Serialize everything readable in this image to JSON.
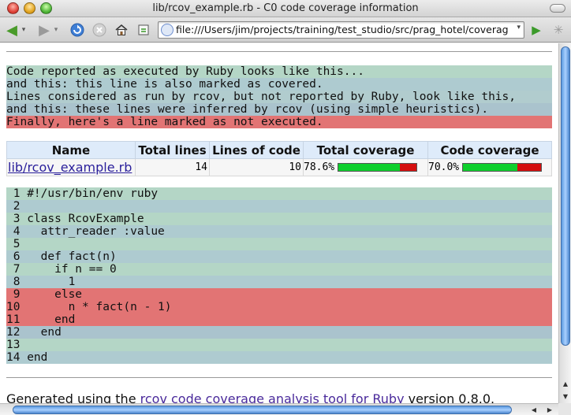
{
  "window": {
    "title": "lib/rcov_example.rb - C0 code coverage information"
  },
  "toolbar": {
    "back": "◀",
    "forward": "▶",
    "drop": "▾",
    "reload": "↻",
    "stop": "✕",
    "home": "⌂",
    "bookmark": "▣",
    "url": "file:///Users/jim/projects/training/test_studio/src/prag_hotel/coverage/lib",
    "go": "▶",
    "throbber": "✳",
    "icons": [
      "back-arrow-icon",
      "forward-arrow-icon",
      "reload-icon",
      "stop-icon",
      "home-icon",
      "bookmark-icon",
      "go-icon",
      "throbber-icon"
    ]
  },
  "legend": [
    {
      "text": "Code reported as executed by Ruby looks like this...",
      "kind": "cov1"
    },
    {
      "text": "and this: this line is also marked as covered.",
      "kind": "cov2"
    },
    {
      "text": "Lines considered as run by rcov, but not reported by Ruby, look like this,",
      "kind": "inf1"
    },
    {
      "text": "and this: these lines were inferred by rcov (using simple heuristics).",
      "kind": "inf2"
    },
    {
      "text": "Finally, here's a line marked as not executed.",
      "kind": "notcov"
    }
  ],
  "report": {
    "headers": [
      "Name",
      "Total lines",
      "Lines of code",
      "Total coverage",
      "Code coverage"
    ],
    "row": {
      "name": "lib/rcov_example.rb",
      "total_lines": "14",
      "lines_of_code": "10",
      "total_coverage": "78.6%",
      "total_coverage_value": 0.786,
      "code_coverage": "70.0%",
      "code_coverage_value": 0.7
    }
  },
  "code": [
    {
      "text": " 1 #!/usr/bin/env ruby",
      "kind": "cov1"
    },
    {
      "text": " 2",
      "kind": "cov2"
    },
    {
      "text": " 3 class RcovExample",
      "kind": "cov1"
    },
    {
      "text": " 4   attr_reader :value",
      "kind": "cov2"
    },
    {
      "text": " 5",
      "kind": "cov1"
    },
    {
      "text": " 6   def fact(n)",
      "kind": "cov2"
    },
    {
      "text": " 7     if n == 0",
      "kind": "cov1"
    },
    {
      "text": " 8       1",
      "kind": "cov2"
    },
    {
      "text": " 9     else",
      "kind": "notcov"
    },
    {
      "text": "10       n * fact(n - 1)",
      "kind": "notcov"
    },
    {
      "text": "11     end",
      "kind": "notcov"
    },
    {
      "text": "12   end",
      "kind": "inf2"
    },
    {
      "text": "13",
      "kind": "cov1"
    },
    {
      "text": "14 end",
      "kind": "cov2"
    }
  ],
  "footer": {
    "prefix": "Generated using the ",
    "link": "rcov code coverage analysis tool for Ruby",
    "suffix": " version 0.8.0."
  },
  "colors": {
    "covered": "#b4d6c6",
    "inferred": "#aecbd0",
    "not_covered": "#e27474",
    "bar_green": "#0ecf2c",
    "bar_red": "#d40e0e"
  }
}
